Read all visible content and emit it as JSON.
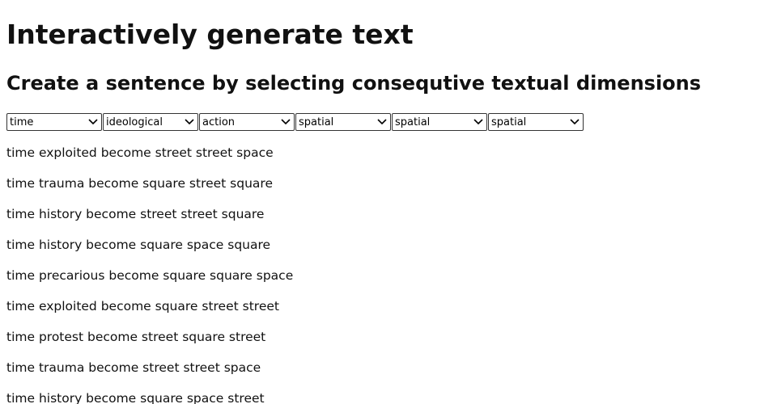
{
  "title": "Interactively generate text",
  "subtitle": "Create a sentence by selecting consequtive textual dimensions",
  "selects": [
    {
      "value": "time",
      "icon": "chevron-down-icon"
    },
    {
      "value": "ideological",
      "icon": "chevron-down-icon"
    },
    {
      "value": "action",
      "icon": "chevron-down-icon"
    },
    {
      "value": "spatial",
      "icon": "chevron-down-icon"
    },
    {
      "value": "spatial",
      "icon": "chevron-down-icon"
    },
    {
      "value": "spatial",
      "icon": "chevron-down-icon"
    }
  ],
  "sentences": [
    "time exploited become street street space",
    "time trauma become square street square",
    "time history become street street square",
    "time history become square space square",
    "time precarious become square square space",
    "time exploited become square street street",
    "time protest become street square street",
    "time trauma become street street space",
    "time history become square space street"
  ]
}
